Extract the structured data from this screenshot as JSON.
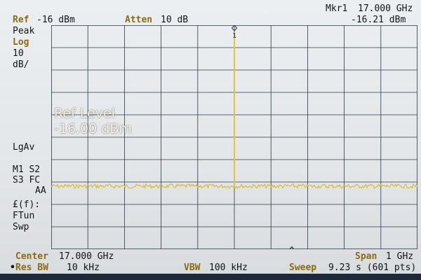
{
  "top": {
    "ref_label": "Ref",
    "ref_value": "-16 dBm",
    "atten_label": "Atten",
    "atten_value": "10 dB",
    "marker_label": "Mkr1",
    "marker_freq": "17.000 GHz",
    "marker_level": "-16.21 dBm"
  },
  "left_panel": {
    "detector": "Peak",
    "scale_label": "Log",
    "scale_value": "10",
    "scale_unit": "dB/",
    "avg": "LgAv",
    "m1_s2": "M1  S2",
    "s3_fc": "S3  FC",
    "aa": "AA",
    "ef": "£(f):",
    "ftun": "FTun",
    "swp": "Swp"
  },
  "overlay": {
    "title": "Ref Level",
    "value": "-16.00 dBm"
  },
  "bottom": {
    "center_label": "Center",
    "center_value": "17.000 GHz",
    "span_label": "Span",
    "span_value": "1 GHz",
    "res_bw_label": "Res BW",
    "res_bw_value": "10 kHz",
    "vbw_label": "VBW",
    "vbw_value": "100 kHz",
    "sweep_label": "Sweep",
    "sweep_value": "9.23 s (601 pts)"
  },
  "marker": {
    "id": "1",
    "x_fraction": 0.5,
    "level_dbm": -16.21
  },
  "colors": {
    "trace": "#d8c040",
    "grid": "#2c3a46",
    "background": "#e6e9eb"
  }
}
